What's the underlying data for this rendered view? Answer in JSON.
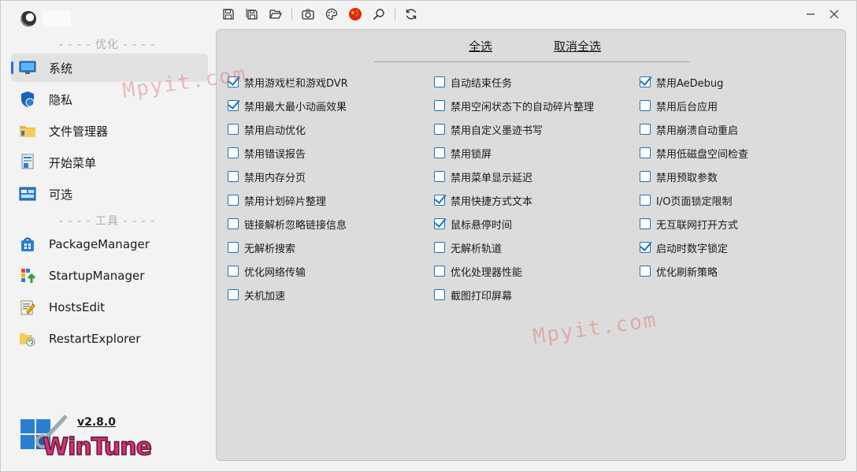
{
  "sidebar": {
    "section_optimize": "- - - - 优化 - - - -",
    "section_tools": "- - - - 工具 - - - -",
    "items": [
      {
        "label": "系统",
        "icon": "monitor-icon",
        "active": true
      },
      {
        "label": "隐私",
        "icon": "shield-icon",
        "active": false
      },
      {
        "label": "文件管理器",
        "icon": "folder-icon",
        "active": false
      },
      {
        "label": "开始菜单",
        "icon": "start-menu-icon",
        "active": false
      },
      {
        "label": "可选",
        "icon": "optional-features-icon",
        "active": false
      }
    ],
    "tools": [
      {
        "label": "PackageManager",
        "icon": "package-icon"
      },
      {
        "label": "StartupManager",
        "icon": "startup-icon"
      },
      {
        "label": "HostsEdit",
        "icon": "hosts-edit-icon"
      },
      {
        "label": "RestartExplorer",
        "icon": "restart-explorer-icon"
      }
    ],
    "version": "v2.8.0",
    "brand": "WinTune"
  },
  "toolbar": {
    "buttons": [
      "save-icon",
      "save-all-icon",
      "open-folder-icon",
      "camera-icon",
      "palette-icon",
      "china-flag-icon",
      "search-icon",
      "refresh-icon"
    ]
  },
  "panel": {
    "select_all": "全选",
    "deselect_all": "取消全选",
    "columns": [
      [
        {
          "label": "禁用游戏栏和游戏DVR",
          "checked": true
        },
        {
          "label": "禁用最大最小动画效果",
          "checked": true
        },
        {
          "label": "禁用启动优化",
          "checked": false
        },
        {
          "label": "禁用错误报告",
          "checked": false
        },
        {
          "label": "禁用内存分页",
          "checked": false
        },
        {
          "label": "禁用计划碎片整理",
          "checked": false
        },
        {
          "label": "链接解析忽略链接信息",
          "checked": false
        },
        {
          "label": "无解析搜索",
          "checked": false
        },
        {
          "label": "优化网络传输",
          "checked": false
        },
        {
          "label": "关机加速",
          "checked": false
        }
      ],
      [
        {
          "label": "自动结束任务",
          "checked": false
        },
        {
          "label": "禁用空闲状态下的自动碎片整理",
          "checked": false
        },
        {
          "label": "禁用自定义墨迹书写",
          "checked": false
        },
        {
          "label": "禁用锁屏",
          "checked": false
        },
        {
          "label": "禁用菜单显示延迟",
          "checked": false
        },
        {
          "label": "禁用快捷方式文本",
          "checked": true
        },
        {
          "label": "鼠标悬停时间",
          "checked": true
        },
        {
          "label": "无解析轨道",
          "checked": false
        },
        {
          "label": "优化处理器性能",
          "checked": false
        },
        {
          "label": "截图打印屏幕",
          "checked": false
        }
      ],
      [
        {
          "label": "禁用AeDebug",
          "checked": true
        },
        {
          "label": "禁用后台应用",
          "checked": false
        },
        {
          "label": "禁用崩溃自动重启",
          "checked": false
        },
        {
          "label": "禁用低磁盘空间检查",
          "checked": false
        },
        {
          "label": "禁用预取参数",
          "checked": false
        },
        {
          "label": "I/O页面锁定限制",
          "checked": false
        },
        {
          "label": "无互联网打开方式",
          "checked": false
        },
        {
          "label": "启动时数字锁定",
          "checked": true
        },
        {
          "label": "优化刷新策略",
          "checked": false
        }
      ]
    ]
  },
  "watermark": "Mpyit.com",
  "colors": {
    "accent": "#1a73b8",
    "active_indicator": "#1a73e8",
    "brand": "#d6326f"
  }
}
